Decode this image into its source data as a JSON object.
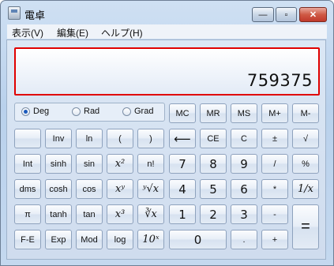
{
  "window": {
    "title": "電卓",
    "minimize": "—",
    "maximize": "▫",
    "close": "✕"
  },
  "menu": [
    "表示(V)",
    "編集(E)",
    "ヘルプ(H)"
  ],
  "display": {
    "value": "759375"
  },
  "angle_modes": [
    {
      "label": "Deg",
      "selected": true
    },
    {
      "label": "Rad",
      "selected": false
    },
    {
      "label": "Grad",
      "selected": false
    }
  ],
  "keys": {
    "mc": "MC",
    "mr": "MR",
    "ms": "MS",
    "mplus": "M+",
    "mminus": "M-",
    "blank": "",
    "inv": "Inv",
    "ln": "ln",
    "lparen": "(",
    "rparen": ")",
    "back": "⟵",
    "ce": "CE",
    "c": "C",
    "pm": "±",
    "sqrt": "√",
    "int": "Int",
    "sinh": "sinh",
    "sin": "sin",
    "sq": "x²",
    "fact": "n!",
    "seven": "7",
    "eight": "8",
    "nine": "9",
    "div": "/",
    "pct": "%",
    "dms": "dms",
    "cosh": "cosh",
    "cos": "cos",
    "pow": "xʸ",
    "root": "ʸ√x",
    "four": "4",
    "five": "5",
    "six": "6",
    "mul": "*",
    "recip": "1/x",
    "pi": "π",
    "tanh": "tanh",
    "tan": "tan",
    "cube": "x³",
    "cbrt": "∛x",
    "one": "1",
    "two": "2",
    "three": "3",
    "minus": "-",
    "fe": "F-E",
    "exp": "Exp",
    "mod": "Mod",
    "log": "log",
    "tenx": "10ˣ",
    "zero": "0",
    "dot": ".",
    "plus": "+",
    "equals": "="
  }
}
